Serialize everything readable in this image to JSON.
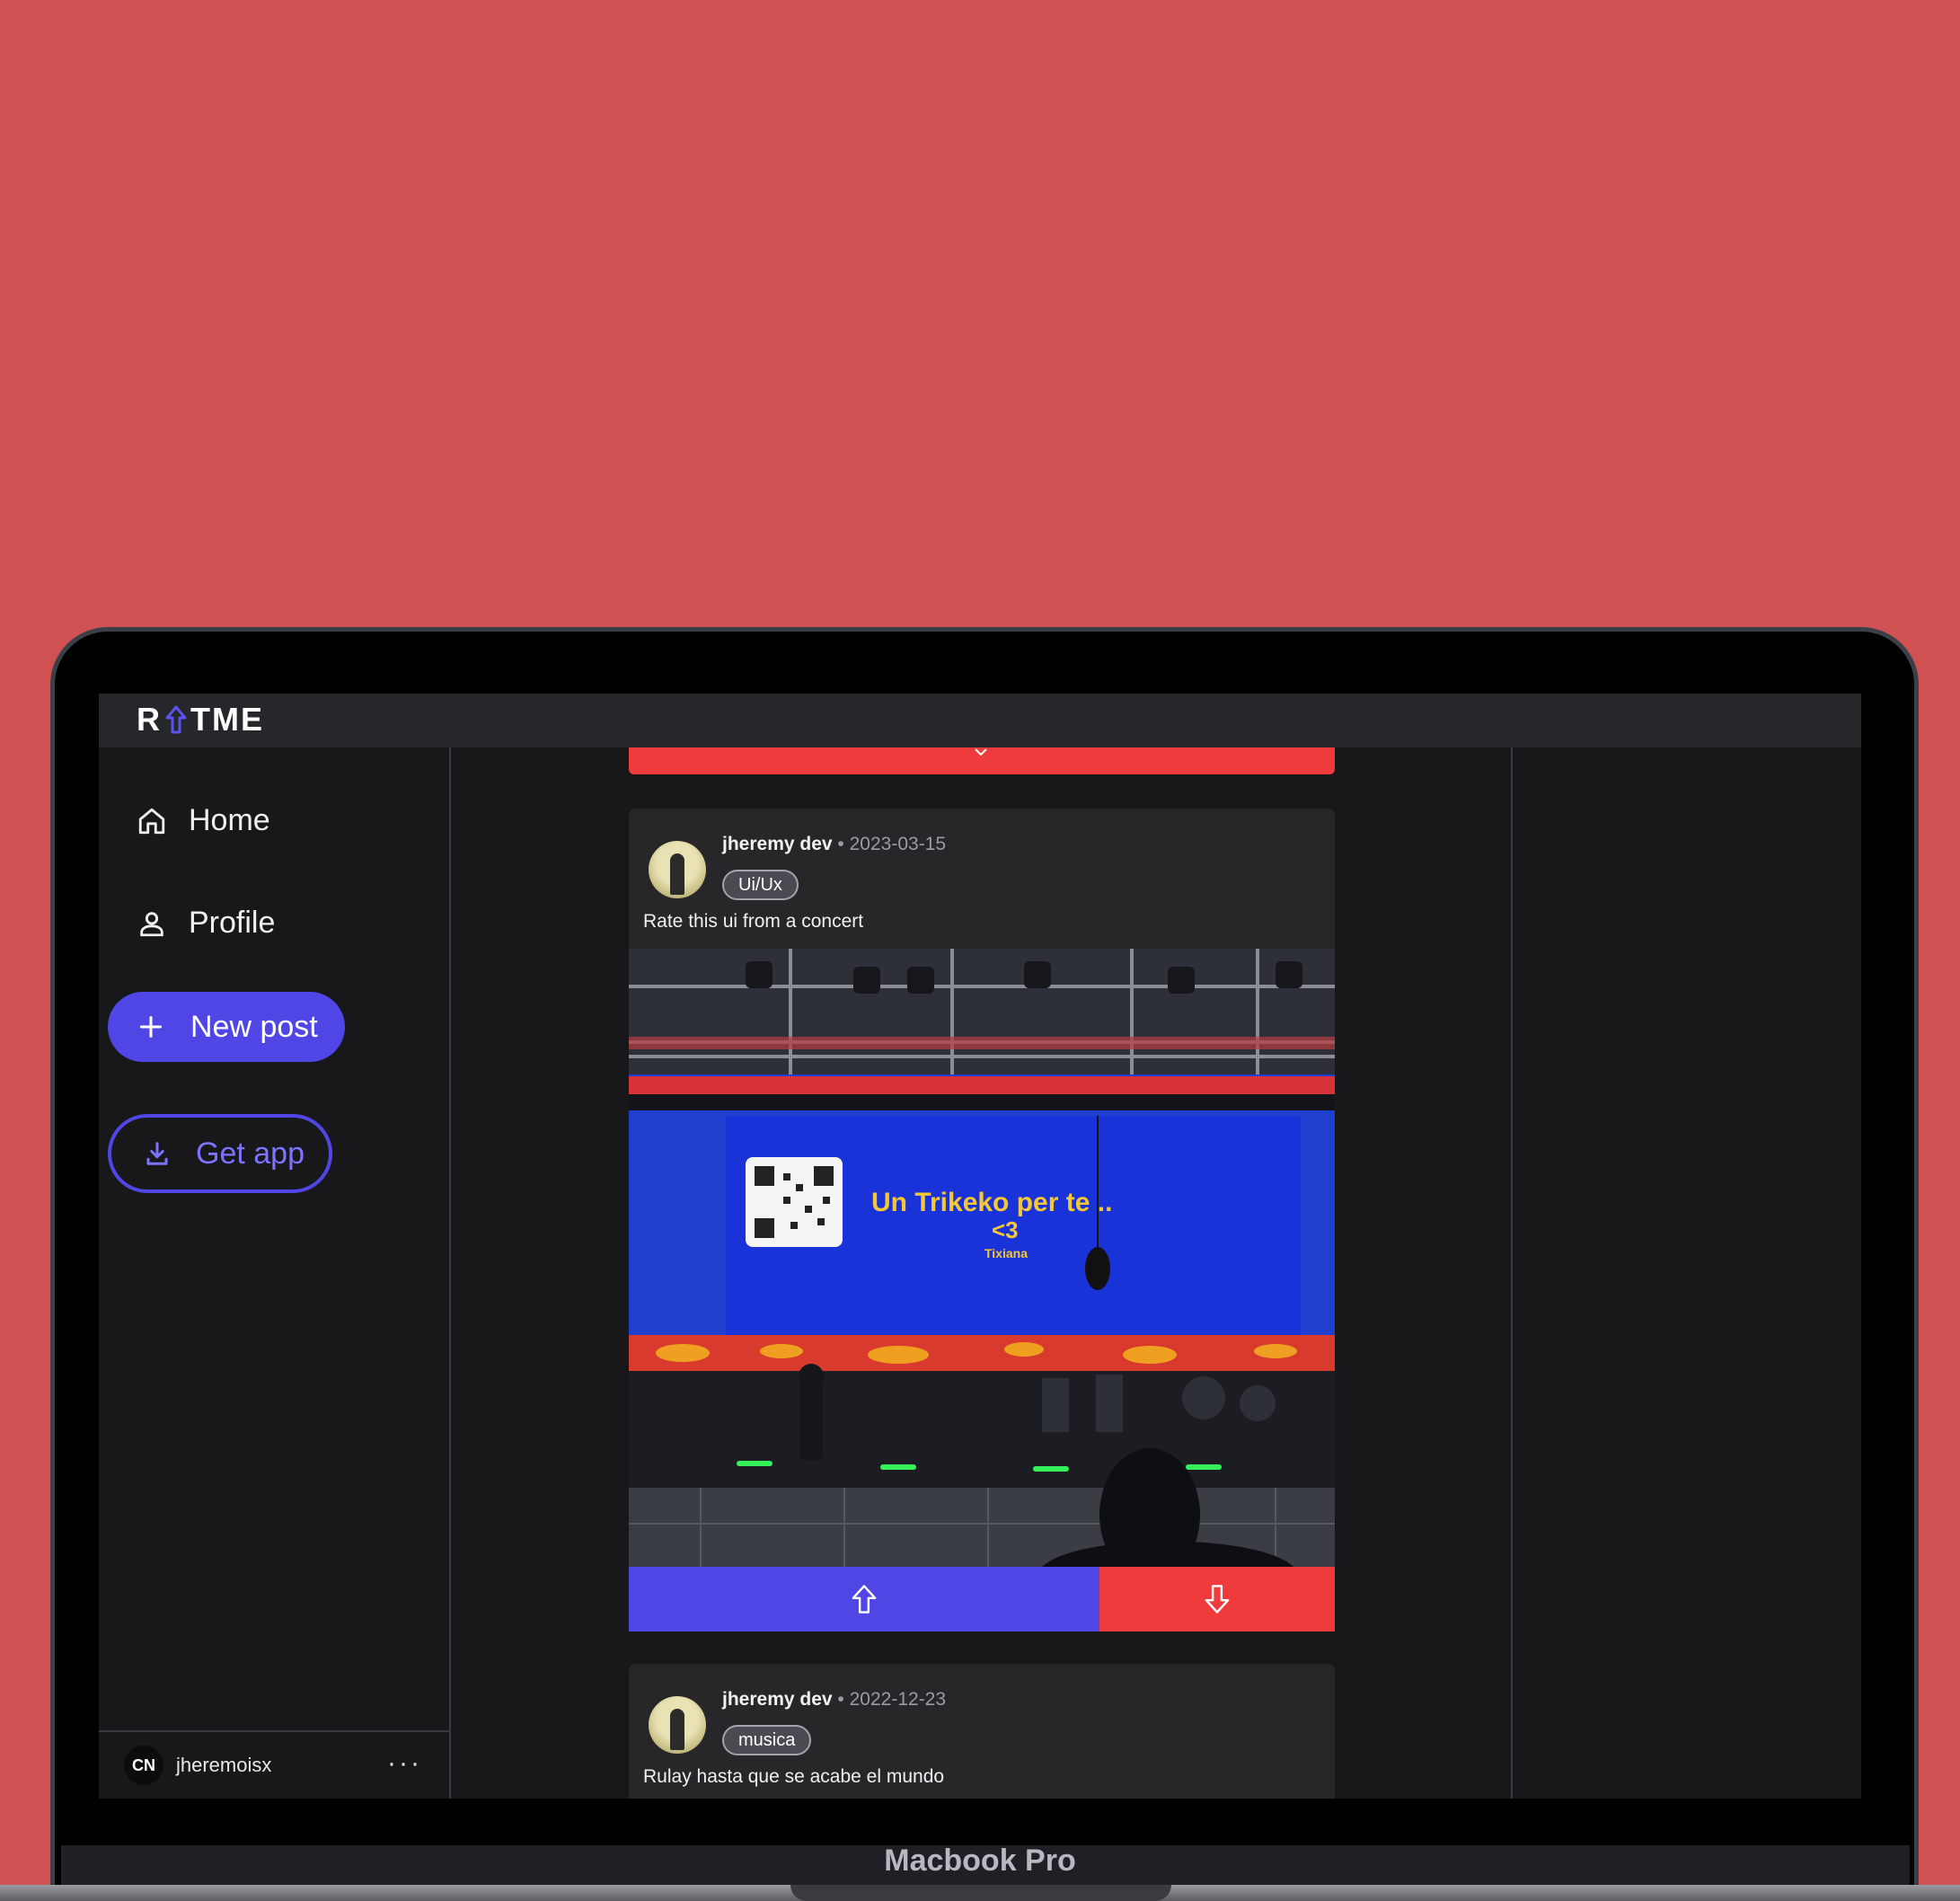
{
  "app": {
    "logo_left": "R",
    "logo_right": "TME"
  },
  "nav": {
    "home": "Home",
    "profile": "Profile",
    "new_post": "New post",
    "get_app": "Get app"
  },
  "user": {
    "avatar_initials": "CN",
    "username": "jheremoisx",
    "more": "···"
  },
  "posts": [
    {
      "author": "jheremy dev",
      "separator": "•",
      "date": "2023-03-15",
      "tag": "Ui/Ux",
      "text": "Rate this ui from a concert",
      "image_screen_text": "Un Trikeko per te ..",
      "image_screen_heart": "<3",
      "image_screen_sub": "Tixiana"
    },
    {
      "author": "jheremy dev",
      "separator": "•",
      "date": "2022-12-23",
      "tag": "musica",
      "text": "Rulay hasta que se acabe el mundo"
    }
  ],
  "device": {
    "label": "Macbook Pro"
  },
  "colors": {
    "background": "#cf5152",
    "accent": "#5046e5",
    "downvote": "#ef3b3b",
    "panel": "#27272a"
  }
}
